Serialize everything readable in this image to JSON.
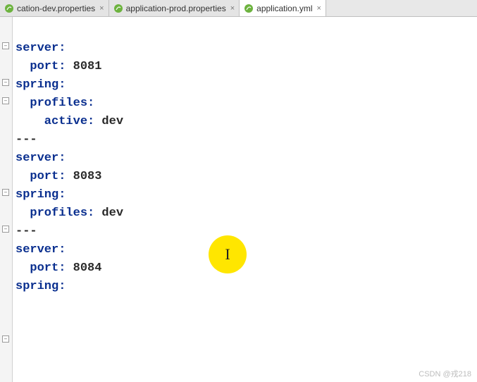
{
  "tabs": [
    {
      "label": "cation-dev.properties",
      "active": false
    },
    {
      "label": "application-prod.properties",
      "active": false
    },
    {
      "label": "application.yml",
      "active": true
    }
  ],
  "code": {
    "l1_key": "server:",
    "l2_key": "  port: ",
    "l2_val": "8081",
    "l3_key": "spring:",
    "l4_key": "  profiles:",
    "l5_key": "    active: ",
    "l5_val": "dev",
    "blank1": "",
    "sep1": "---",
    "l6_key": "server:",
    "l7_key": "  port: ",
    "l7_val": "8083",
    "l8_key": "spring:",
    "l9_key": "  profiles: ",
    "l9_val": "dev",
    "blank2": "",
    "blank3": "",
    "sep2": "---",
    "blank4": "",
    "l10_key": "server:",
    "l11_key": "  port: ",
    "l11_val": "8084",
    "l12_key": "spring:"
  },
  "cursor_glyph": "I",
  "watermark": "CSDN @戎218"
}
